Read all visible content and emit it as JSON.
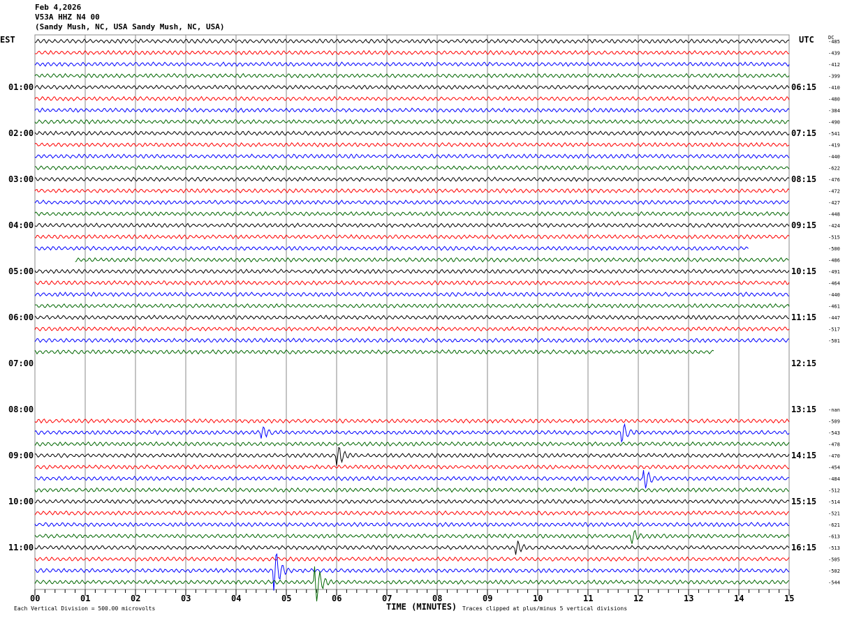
{
  "header": {
    "date": "Feb 4,2026",
    "station": "V53A HHZ N4 00",
    "location": "(Sandy Mush, NC, USA Sandy Mush, NC, USA)"
  },
  "chart_data": {
    "type": "line",
    "title": "V53A HHZ N4 00 helicorder, Feb 4,2026",
    "left_tz": "EST",
    "right_tz": "UTC",
    "dc_header": "DC",
    "xlabel": "TIME (MINUTES)",
    "x_ticks": [
      "00",
      "01",
      "02",
      "03",
      "04",
      "05",
      "06",
      "07",
      "08",
      "09",
      "10",
      "11",
      "12",
      "13",
      "14",
      "15"
    ],
    "xlim": [
      0,
      15
    ],
    "minutes_per_row": 15,
    "left_hour_labels": [
      "01:00",
      "02:00",
      "03:00",
      "04:00",
      "05:00",
      "06:00",
      "07:00",
      "08:00",
      "09:00",
      "10:00",
      "11:00"
    ],
    "right_hour_labels": [
      "06:15",
      "07:15",
      "08:15",
      "09:15",
      "10:15",
      "11:15",
      "12:15",
      "13:15",
      "14:15",
      "15:15",
      "16:15"
    ],
    "trace_colors": [
      "#000000",
      "#ff0000",
      "#0000ff",
      "#006600"
    ],
    "dc_values": [
      "-485",
      "-439",
      "-412",
      "-399",
      "-410",
      "-480",
      "-384",
      "-490",
      "-541",
      "-419",
      "-440",
      "-622",
      "-476",
      "-472",
      "-427",
      "-448",
      "-424",
      "-515",
      "-500",
      "-486",
      "-491",
      "-464",
      "-440",
      "-461",
      "-447",
      "-517",
      "-501",
      "",
      "",
      "",
      "",
      "",
      "-nan",
      "-509",
      "-543",
      "-478",
      "-470",
      "-454",
      "-484",
      "-512",
      "-514",
      "-521",
      "-621",
      "-613",
      "-513",
      "-505",
      "-502",
      "-544"
    ],
    "missing_rows": [
      28,
      29,
      30,
      31,
      32
    ],
    "partial_rows": [
      {
        "row": 18,
        "end_min": 14.2
      },
      {
        "row": 19,
        "start_min": 0.8
      },
      {
        "row": 27,
        "end_min": 13.5
      }
    ],
    "events": [
      {
        "row": 34,
        "minute": 4.55,
        "amplitude": 0.4
      },
      {
        "row": 34,
        "minute": 11.7,
        "amplitude": 0.7
      },
      {
        "row": 36,
        "minute": 6.05,
        "amplitude": 0.7
      },
      {
        "row": 38,
        "minute": 12.15,
        "amplitude": 0.7
      },
      {
        "row": 43,
        "minute": 11.9,
        "amplitude": 0.5
      },
      {
        "row": 44,
        "minute": 9.6,
        "amplitude": 0.5
      },
      {
        "row": 46,
        "minute": 4.8,
        "amplitude": 1.5
      },
      {
        "row": 47,
        "minute": 5.6,
        "amplitude": 1.6
      }
    ],
    "footer_scale": "Each Vertical Division =  500.00 microvolts",
    "footer_clip": "Traces clipped at plus/minus 5 vertical divisions"
  }
}
